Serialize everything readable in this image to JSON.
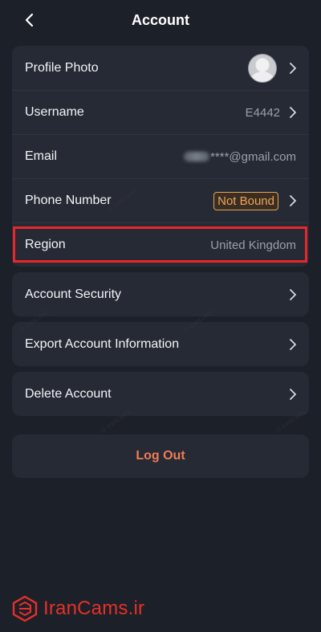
{
  "header": {
    "title": "Account",
    "back_icon": "chevron-left-icon"
  },
  "profile_card": {
    "rows": [
      {
        "label": "Profile Photo",
        "value": ""
      },
      {
        "label": "Username",
        "value": "E4442"
      },
      {
        "label": "Email",
        "value": "****@gmail.com"
      },
      {
        "label": "Phone Number",
        "value": "Not Bound"
      },
      {
        "label": "Region",
        "value": "United Kingdom"
      }
    ]
  },
  "security_row": {
    "label": "Account Security"
  },
  "export_row": {
    "label": "Export Account Information"
  },
  "delete_row": {
    "label": "Delete Account"
  },
  "logout": {
    "label": "Log Out"
  },
  "watermark": {
    "brand": "IranCams.ir"
  },
  "colors": {
    "background": "#1c2029",
    "card": "#252a35",
    "accent_orange": "#f0a35a",
    "logout_text": "#f07b55",
    "highlight_red": "#e8272b"
  }
}
